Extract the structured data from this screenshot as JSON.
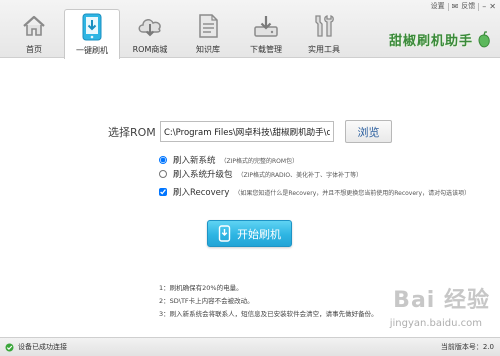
{
  "window": {
    "settings_label": "设置",
    "feedback_label": "反馈"
  },
  "nav": {
    "tabs": [
      {
        "label": "首页",
        "icon": "home-icon"
      },
      {
        "label": "一键刷机",
        "icon": "phone-download-icon",
        "active": true
      },
      {
        "label": "ROM商城",
        "icon": "cloud-download-icon"
      },
      {
        "label": "知识库",
        "icon": "document-icon"
      },
      {
        "label": "下载管理",
        "icon": "download-manager-icon"
      },
      {
        "label": "实用工具",
        "icon": "tools-icon"
      }
    ]
  },
  "brand": {
    "name": "甜椒刷机助手"
  },
  "rom": {
    "label": "选择ROM",
    "path_value": "C:\\Program Files\\网卓科技\\甜椒刷机助手\\dov",
    "browse_label": "浏览"
  },
  "options": [
    {
      "label": "刷入新系统",
      "desc": "（ZIP格式的完整的ROM包）",
      "type": "radio",
      "checked": true
    },
    {
      "label": "刷入系统升级包",
      "desc": "（ZIP格式的RADIO、美化补丁、字体补丁等）",
      "type": "radio",
      "checked": false
    },
    {
      "label": "刷入Recovery",
      "desc": "（如果您知道什么是Recovery，并且不想更换您当前使用的Recovery，请对勾选该项）",
      "type": "checkbox",
      "checked": true
    }
  ],
  "start_button": {
    "label": "开始刷机"
  },
  "tips": [
    "1：刷机确保有20%的电量。",
    "2：SD\\TF卡上内容不会被改动。",
    "3：刷入新系统会将联系人，短信息及已安装软件会清空，请事先做好备份。"
  ],
  "watermark": {
    "logo": "Bai 经验",
    "url": "jingyan.baidu.com"
  },
  "status": {
    "device_status": "设备已成功连接",
    "version": "当前版本号：2.0"
  },
  "colors": {
    "accent": "#2eb5e3",
    "brand_green": "#3a8a3a",
    "status_ok": "#3aa63a"
  }
}
